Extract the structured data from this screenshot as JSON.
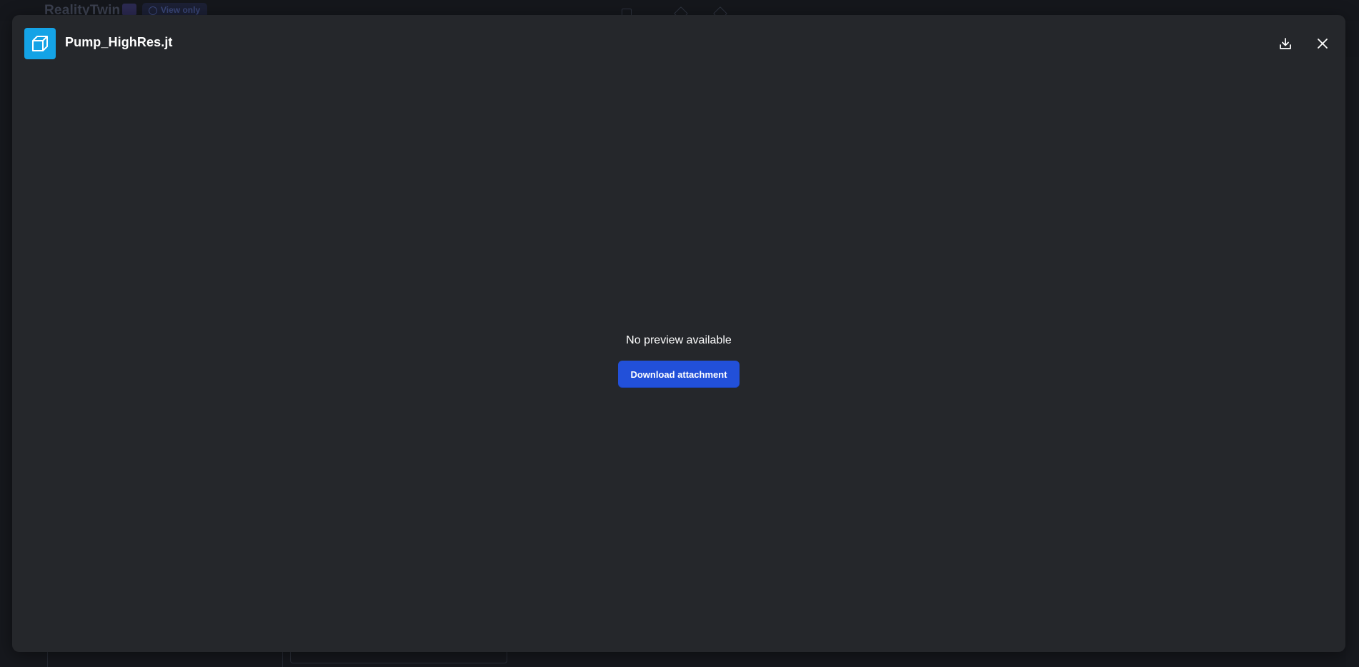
{
  "background_app": {
    "brand": "RealityTwin",
    "badge": "View only"
  },
  "modal": {
    "file_name": "Pump_HighRes.jt",
    "file_icon": "cube-icon",
    "file_icon_color": "#14a3e6",
    "download_icon": "download-icon",
    "close_icon": "close-icon",
    "empty_message": "No preview available",
    "download_button_label": "Download attachment",
    "accent_color": "#2250d9"
  }
}
